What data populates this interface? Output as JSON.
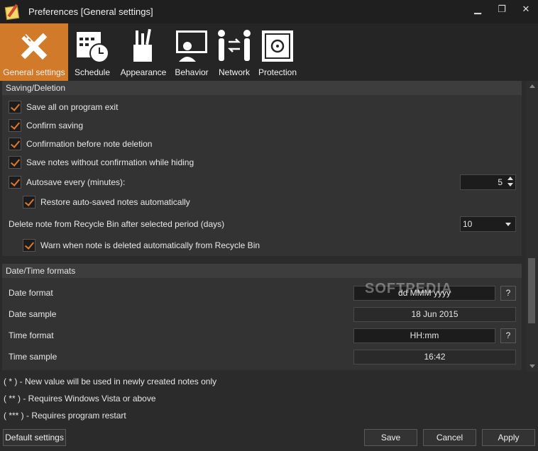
{
  "window": {
    "title": "Preferences [General settings]",
    "minimize_glyph": "▁",
    "maximize_glyph": "❐",
    "close_glyph": "✕"
  },
  "tabs": [
    {
      "label": "General settings",
      "icon": "pencil-ruler-icon",
      "active": true
    },
    {
      "label": "Schedule",
      "icon": "calendar-clock-icon",
      "active": false
    },
    {
      "label": "Appearance",
      "icon": "brush-cup-icon",
      "active": false
    },
    {
      "label": "Behavior",
      "icon": "user-monitor-icon",
      "active": false
    },
    {
      "label": "Network",
      "icon": "people-transfer-icon",
      "active": false
    },
    {
      "label": "Protection",
      "icon": "safe-icon",
      "active": false
    }
  ],
  "saving": {
    "header": "Saving/Deletion",
    "save_all": "Save all on program exit",
    "confirm_saving": "Confirm saving",
    "confirm_deletion": "Confirmation before note deletion",
    "save_without_confirm": "Save notes without confirmation while hiding",
    "autosave": "Autosave every (minutes):",
    "autosave_value": "5",
    "restore_autosaved": "Restore auto-saved notes automatically",
    "delete_period_label": "Delete note from Recycle Bin after selected period (days)",
    "delete_period_value": "10",
    "warn_deleted": "Warn when note is deleted automatically from Recycle Bin"
  },
  "datetime": {
    "header": "Date/Time formats",
    "date_format_label": "Date format",
    "date_format_value": "dd MMM yyyy",
    "date_sample_label": "Date sample",
    "date_sample_value": "18 Jun 2015",
    "time_format_label": "Time format",
    "time_format_value": "HH:mm",
    "time_sample_label": "Time sample",
    "time_sample_value": "16:42",
    "help_label": "?"
  },
  "notes": {
    "n1": "( * ) - New value will be used in newly created notes only",
    "n2": "( ** ) - Requires Windows Vista or above",
    "n3": "( *** ) - Requires program restart"
  },
  "buttons": {
    "default": "Default settings",
    "save": "Save",
    "cancel": "Cancel",
    "apply": "Apply"
  },
  "watermark": "SOFTPEDIA",
  "colors": {
    "accent": "#d07a2a",
    "check": "#e0782a",
    "background": "#2b2b2b"
  }
}
